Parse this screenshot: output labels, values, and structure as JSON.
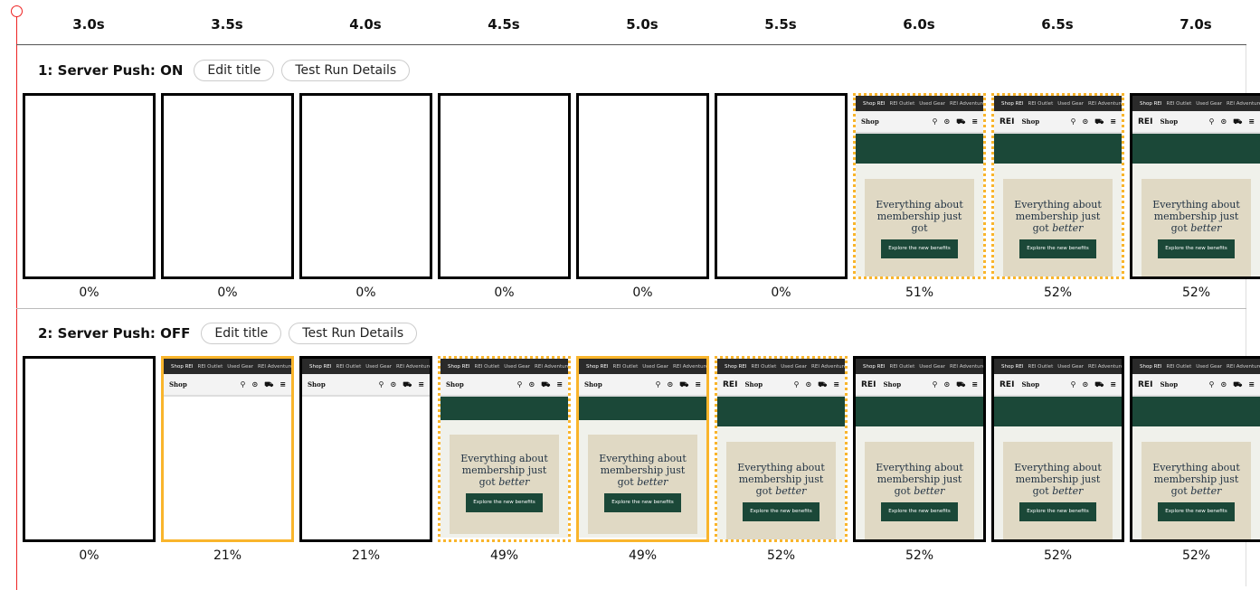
{
  "timeline": [
    "3.0s",
    "3.5s",
    "4.0s",
    "4.5s",
    "5.0s",
    "5.5s",
    "6.0s",
    "6.5s",
    "7.0s"
  ],
  "colors": {
    "highlight": "#f9b52c",
    "cursor": "#e22222",
    "brand_green": "#1b4838"
  },
  "page": {
    "topbar": [
      "Shop REI",
      "REI Outlet",
      "Used Gear",
      "REI Adventures"
    ],
    "nav_label": "Shop",
    "logo": "REI",
    "nav_icons": [
      "search-icon",
      "location-icon",
      "cart-icon",
      "menu-icon"
    ],
    "hero_line1": "Everything about",
    "hero_line2": "membership just",
    "hero_line3": "got",
    "hero_em": "better",
    "cta": "Explore the new benefits"
  },
  "rows": [
    {
      "title": "1: Server Push: ON",
      "edit": "Edit title",
      "details": "Test Run Details",
      "frames": [
        {
          "state": "blank",
          "border": "black",
          "pct": "0%"
        },
        {
          "state": "blank",
          "border": "black",
          "pct": "0%"
        },
        {
          "state": "blank",
          "border": "black",
          "pct": "0%"
        },
        {
          "state": "blank",
          "border": "black",
          "pct": "0%"
        },
        {
          "state": "blank",
          "border": "black",
          "pct": "0%"
        },
        {
          "state": "blank",
          "border": "black",
          "pct": "0%"
        },
        {
          "state": "full",
          "border": "dotted",
          "pct": "51%",
          "logo": false,
          "better": false,
          "compact": false
        },
        {
          "state": "full",
          "border": "dotted",
          "pct": "52%",
          "logo": true,
          "better": true,
          "compact": false
        },
        {
          "state": "full",
          "border": "black",
          "pct": "52%",
          "logo": true,
          "better": true,
          "compact": false
        }
      ]
    },
    {
      "title": "2: Server Push: OFF",
      "edit": "Edit title",
      "details": "Test Run Details",
      "frames": [
        {
          "state": "blank",
          "border": "black",
          "pct": "0%"
        },
        {
          "state": "nav",
          "border": "orange",
          "pct": "21%"
        },
        {
          "state": "nav",
          "border": "black",
          "pct": "21%"
        },
        {
          "state": "full",
          "border": "dotted",
          "pct": "49%",
          "logo": false,
          "better": true,
          "compact": true
        },
        {
          "state": "full",
          "border": "orange",
          "pct": "49%",
          "logo": false,
          "better": true,
          "compact": true
        },
        {
          "state": "full",
          "border": "dotted",
          "pct": "52%",
          "logo": true,
          "better": true,
          "compact": false
        },
        {
          "state": "full",
          "border": "black",
          "pct": "52%",
          "logo": true,
          "better": true,
          "compact": false
        },
        {
          "state": "full",
          "border": "black",
          "pct": "52%",
          "logo": true,
          "better": true,
          "compact": false
        },
        {
          "state": "full",
          "border": "black",
          "pct": "52%",
          "logo": true,
          "better": true,
          "compact": false
        }
      ]
    }
  ]
}
